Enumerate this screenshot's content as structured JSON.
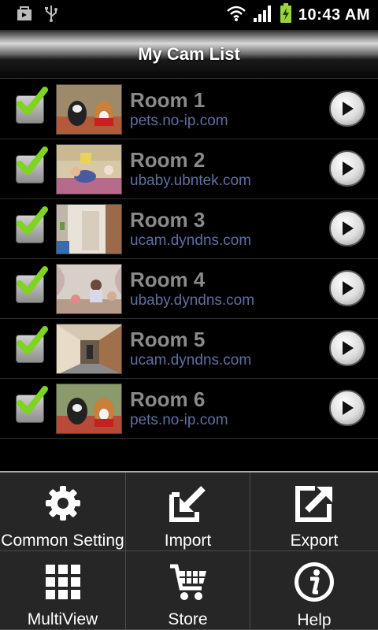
{
  "status_bar": {
    "time": "10:43 AM",
    "icons": [
      "shopping-bag-icon",
      "usb-icon",
      "wifi-icon",
      "signal-icon",
      "battery-charging-icon"
    ]
  },
  "header": {
    "title": "My Cam List"
  },
  "cameras": [
    {
      "name": "Room 1",
      "host": "pets.no-ip.com",
      "checked": true
    },
    {
      "name": "Room 2",
      "host": "ubaby.ubntek.com",
      "checked": true
    },
    {
      "name": "Room 3",
      "host": "ucam.dyndns.com",
      "checked": true
    },
    {
      "name": "Room 4",
      "host": "ubaby.dyndns.com",
      "checked": true
    },
    {
      "name": "Room 5",
      "host": "ucam.dyndns.com",
      "checked": true
    },
    {
      "name": "Room 6",
      "host": "pets.no-ip.com",
      "checked": true
    }
  ],
  "menu": [
    {
      "label": "Common Setting",
      "icon": "gear-icon"
    },
    {
      "label": "Import",
      "icon": "import-icon"
    },
    {
      "label": "Export",
      "icon": "export-icon"
    },
    {
      "label": "MultiView",
      "icon": "grid-icon"
    },
    {
      "label": "Store",
      "icon": "cart-icon"
    },
    {
      "label": "Help",
      "icon": "info-icon"
    }
  ],
  "colors": {
    "check_green": "#7fd321",
    "host_text": "#5f6fa0",
    "name_text": "#8a8a8a",
    "battery": "#9ad43a"
  }
}
